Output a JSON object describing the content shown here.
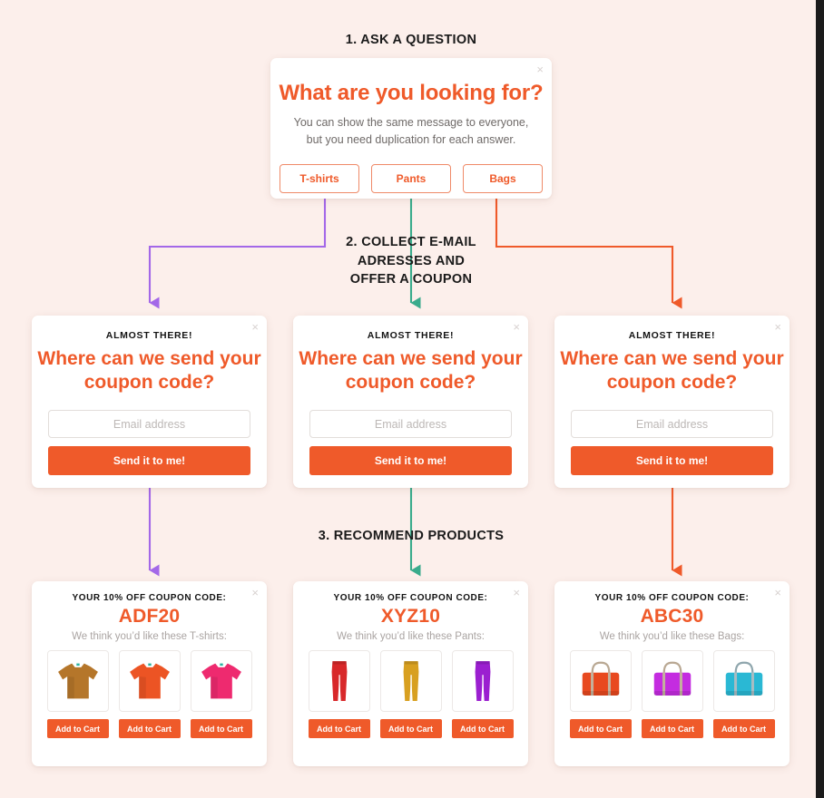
{
  "theme": {
    "background": "#fcefeb",
    "accent_orange": "#ef5a2a",
    "wire_purple": "#a368e8",
    "wire_green": "#3aab8c",
    "wire_orange": "#ef5a2a",
    "card_bg": "#ffffff",
    "heading_color": "#1a1a1a"
  },
  "steps": {
    "step1_label": "1. ASK A QUESTION",
    "step2_label": "2. COLLECT E-MAIL\nADRESSES AND\nOFFER A COUPON",
    "step2_line1": "2. COLLECT E-MAIL",
    "step2_line2": "ADRESSES AND",
    "step2_line3": "OFFER A COUPON",
    "step3_label": "3. RECOMMEND PRODUCTS"
  },
  "question_card": {
    "close_icon": "close-icon",
    "close_glyph": "×",
    "title": "What are you looking for?",
    "subtitle": "You can show the same message to everyone, but you need duplication for each answer.",
    "options": [
      {
        "label": "T-shirts",
        "dot_color": "#a368e8"
      },
      {
        "label": "Pants",
        "dot_color": "#3aab8c"
      },
      {
        "label": "Bags",
        "dot_color": "#ef5a2a"
      }
    ]
  },
  "email_cards": [
    {
      "close_glyph": "×",
      "kicker": "ALMOST THERE!",
      "title": "Where can we send your coupon code?",
      "input_value": "",
      "input_placeholder": "Email address",
      "submit_label": "Send it to me!"
    },
    {
      "close_glyph": "×",
      "kicker": "ALMOST THERE!",
      "title": "Where can we send your coupon code?",
      "input_value": "",
      "input_placeholder": "Email address",
      "submit_label": "Send it to me!"
    },
    {
      "close_glyph": "×",
      "kicker": "ALMOST THERE!",
      "title": "Where can we send your coupon code?",
      "input_value": "",
      "input_placeholder": "Email address",
      "submit_label": "Send it to me!"
    }
  ],
  "product_cards": [
    {
      "close_glyph": "×",
      "kicker": "YOUR 10% OFF COUPON CODE:",
      "code": "ADF20",
      "subtitle": "We think you’d like these T-shirts:",
      "product_type": "tshirt",
      "items": [
        {
          "icon": "tshirt-icon",
          "color": "#b5762a",
          "cart_label": "Add to Cart"
        },
        {
          "icon": "tshirt-icon",
          "color": "#ec5424",
          "cart_label": "Add to Cart"
        },
        {
          "icon": "tshirt-icon",
          "color": "#ee2a6f",
          "cart_label": "Add to Cart"
        }
      ]
    },
    {
      "close_glyph": "×",
      "kicker": "YOUR 10% OFF COUPON CODE:",
      "code": "XYZ10",
      "subtitle": "We think you’d like these Pants:",
      "product_type": "pants",
      "items": [
        {
          "icon": "pants-icon",
          "color": "#d8282a",
          "cart_label": "Add to Cart"
        },
        {
          "icon": "pants-icon",
          "color": "#d8a020",
          "cart_label": "Add to Cart"
        },
        {
          "icon": "pants-icon",
          "color": "#9b1fd0",
          "cart_label": "Add to Cart"
        }
      ]
    },
    {
      "close_glyph": "×",
      "kicker": "YOUR 10% OFF COUPON CODE:",
      "code": "ABC30",
      "subtitle": "We think you’d like these Bags:",
      "product_type": "bag",
      "items": [
        {
          "icon": "handbag-icon",
          "color": "#e8491f",
          "cart_label": "Add to Cart"
        },
        {
          "icon": "handbag-icon",
          "color": "#c42ce0",
          "cart_label": "Add to Cart"
        },
        {
          "icon": "handbag-icon",
          "color": "#2ab8d4",
          "cart_label": "Add to Cart"
        }
      ]
    }
  ]
}
